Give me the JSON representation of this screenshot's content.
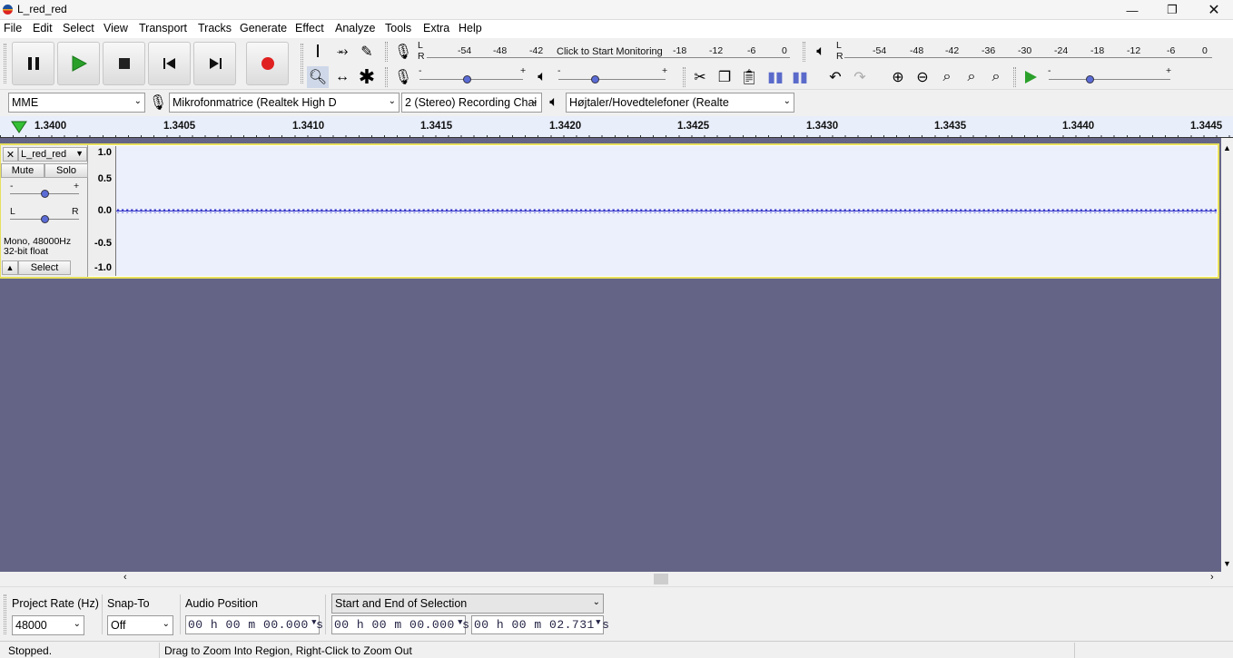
{
  "window": {
    "title": "L_red_red"
  },
  "menu": [
    "File",
    "Edit",
    "Select",
    "View",
    "Transport",
    "Tracks",
    "Generate",
    "Effect",
    "Analyze",
    "Tools",
    "Extra",
    "Help"
  ],
  "meters": {
    "record_scale": [
      "-54",
      "-48",
      "-42",
      "-18",
      "-12",
      "-6",
      "0"
    ],
    "record_prompt": "Click to Start Monitoring",
    "play_scale": [
      "-54",
      "-48",
      "-42",
      "-36",
      "-30",
      "-24",
      "-18",
      "-12",
      "-6",
      "0"
    ],
    "lr_l": "L",
    "lr_r": "R",
    "slider_minus": "-",
    "slider_plus": "+"
  },
  "device": {
    "host": "MME",
    "recording_device": "Mikrofonmatrice (Realtek High D",
    "channels": "2 (Stereo) Recording Chai",
    "playback_device": "Højtaler/Hovedtelefoner (Realte"
  },
  "ruler": {
    "ticks": [
      "1.3400",
      "1.3405",
      "1.3410",
      "1.3415",
      "1.3420",
      "1.3425",
      "1.3430",
      "1.3435",
      "1.3440",
      "1.3445"
    ]
  },
  "track": {
    "name": "L_red_red",
    "close": "✕",
    "mute": "Mute",
    "solo": "Solo",
    "gain_minus": "-",
    "gain_plus": "+",
    "pan_l": "L",
    "pan_r": "R",
    "info_line1": "Mono, 48000Hz",
    "info_line2": "32-bit float",
    "select": "Select",
    "scale": [
      "1.0",
      "0.5",
      "0.0",
      "-0.5",
      "-1.0"
    ]
  },
  "bottom": {
    "project_rate_label": "Project Rate (Hz)",
    "project_rate_value": "48000",
    "snap_to_label": "Snap-To",
    "snap_to_value": "Off",
    "audio_position_label": "Audio Position",
    "audio_position_value": "00 h 00 m 00.000 s",
    "selection_mode": "Start and End of Selection",
    "selection_start": "00 h 00 m 00.000 s",
    "selection_end": "00 h 00 m 02.731 s"
  },
  "status": {
    "state": "Stopped.",
    "hint": "Drag to Zoom Into Region, Right-Click to Zoom Out"
  },
  "colors": {
    "track_bg": "#646586",
    "wave_bg": "#ecf0fc",
    "wave_line": "#3232c8",
    "record_red": "#e02020",
    "play_green": "#2aa02a"
  }
}
